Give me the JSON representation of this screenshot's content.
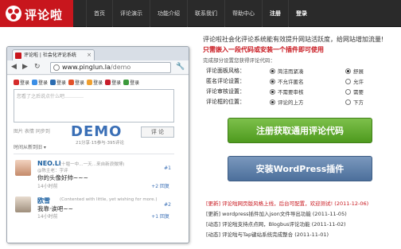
{
  "brand": {
    "name": "评论啦",
    "accent": "#c8161d"
  },
  "nav": [
    {
      "label": "首页",
      "bold": false
    },
    {
      "label": "评论演示",
      "bold": false
    },
    {
      "label": "功能介绍",
      "bold": false
    },
    {
      "label": "联系我们",
      "bold": false
    },
    {
      "label": "帮助中心",
      "bold": false
    },
    {
      "label": "注册",
      "bold": true
    },
    {
      "label": "登录",
      "bold": true
    }
  ],
  "browser": {
    "tab_title": "评论啦 | 社会化评论系统",
    "url_host": "www.pinglun.la",
    "url_path": "/demo",
    "logins": [
      "登录",
      "登录",
      "登录",
      "登录",
      "登录",
      "登录",
      "登录"
    ],
    "comment_placeholder": "您看了之后说点什么吧…………",
    "row_hint": "图片  表情  同步到",
    "submit_label": "评 论",
    "demo_label": "DEMO",
    "counts": "21分享·15参与·395评论",
    "sort_label": "时间从新到旧 ▾",
    "comments": [
      {
        "name": "NEO.Li",
        "meta": "(十堰一中…一天…来自新浪微博)",
        "sub": "@陈主老：字评",
        "text": "你的头像好帅~~~",
        "time": "14小时前",
        "num": "#1",
        "action": "+2 回复"
      },
      {
        "name": "欧雪",
        "meta": "(Contented with little, yet wishing for more.)",
        "sub": "",
        "text": "我靠·诶吧~~",
        "time": "14小时前",
        "num": "#2",
        "action": "+1 回复"
      }
    ]
  },
  "intro": {
    "line1": "评论啦社会化评论系统能有效提升网站活跃度，给网站增加流量!",
    "line2": "只需嵌入一段代码或安装一个插件即可使用",
    "line3": "完成部分设置您获得评论代码："
  },
  "options": [
    {
      "label": "评论面板风格：",
      "choices": [
        {
          "text": "简洁而紧凑",
          "on": true
        },
        {
          "text": "舒展",
          "on": true
        }
      ]
    },
    {
      "label": "匿名评论设置：",
      "choices": [
        {
          "text": "不允许匿名",
          "on": true
        },
        {
          "text": "允许",
          "on": false
        }
      ]
    },
    {
      "label": "评论审核设置：",
      "choices": [
        {
          "text": "不需要审核",
          "on": true
        },
        {
          "text": "需要",
          "on": false
        }
      ]
    },
    {
      "label": "评论框的位置：",
      "choices": [
        {
          "text": "评论的上方",
          "on": true
        },
        {
          "text": "下方",
          "on": false
        }
      ]
    }
  ],
  "buttons": {
    "register": "注册获取通用评论代码",
    "wordpress": "安装WordPress插件"
  },
  "news": [
    {
      "text": "[更新] 评论啦网页版风格上线，后台可配置，欢迎测试! (2011-12-06)",
      "hot": true
    },
    {
      "text": "[更新] wordpress插件加入json文件导出功能 (2011-11-05)",
      "hot": false
    },
    {
      "text": "[动态] 评论啦支持点点网，Blogbus评论功能 (2011-11-02)",
      "hot": false
    },
    {
      "text": "[动态] 评论啦与Tap键站系统完成整合 (2011-11-01)",
      "hot": false
    }
  ]
}
